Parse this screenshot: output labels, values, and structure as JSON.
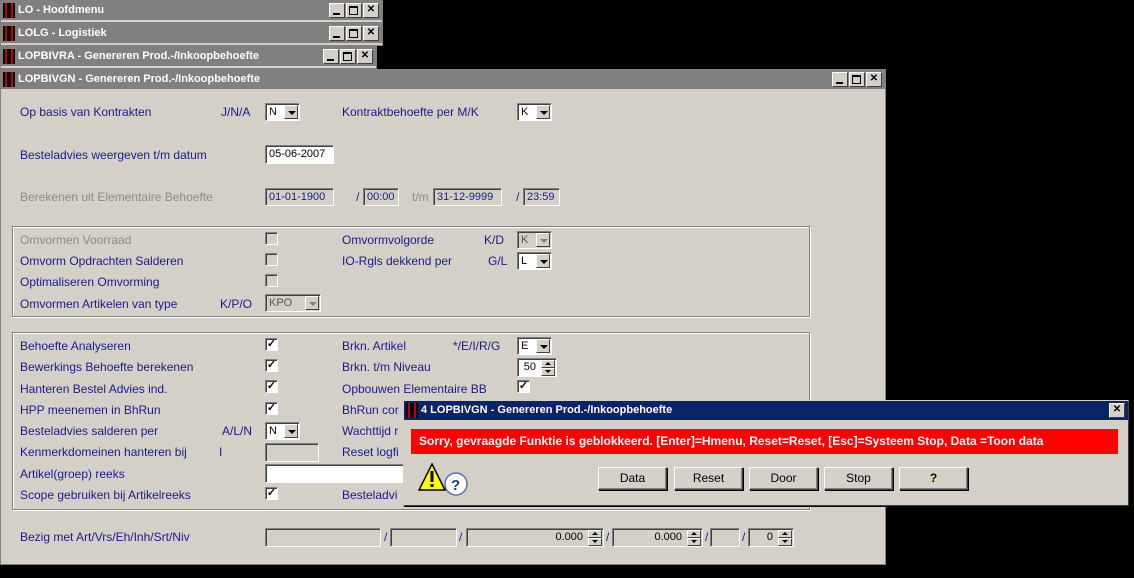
{
  "windows": {
    "w1": "LO - Hoofdmenu",
    "w2": "LOLG - Logistiek",
    "w3": "LOPBIVRA - Genereren Prod.-/Inkoopbehoefte",
    "main": "LOPBIVGN - Genereren Prod.-/Inkoopbehoefte"
  },
  "form": {
    "kontrakten_label": "Op basis van Kontrakten",
    "kontrakten_hint": "J/N/A",
    "kontrakten_value": "N",
    "kontraktbehoefte_label": "Kontraktbehoefte per M/K",
    "kontraktbehoefte_value": "K",
    "besteladvies_label": "Besteladvies weergeven t/m datum",
    "besteladvies_date": "05-06-2007",
    "berekenen_label": "Berekenen uit Elementaire Behoefte",
    "from_date": "01-01-1900",
    "from_time": "00:00",
    "tm_label": "t/m",
    "to_date": "31-12-9999",
    "to_time": "23:59",
    "slash": "/",
    "omvormen_voorraad": "Omvormen Voorraad",
    "omvorm_opdrachten": "Omvorm Opdrachten Salderen",
    "optimaliseren": "Optimaliseren Omvorming",
    "omvormen_artikelen": "Omvormen Artikelen van type",
    "omvormen_artikelen_hint": "K/P/O",
    "omvormen_artikelen_value": "KPO",
    "omvormvolgorde_label": "Omvormvolgorde",
    "omvormvolgorde_hint": "K/D",
    "omvormvolgorde_value": "K",
    "iorgls_label": "IO-Rgls dekkend per",
    "iorgls_hint": "G/L",
    "iorgls_value": "L",
    "behoefte_analyseren": "Behoefte Analyseren",
    "bewerkings": "Bewerkings Behoefte berekenen",
    "hanteren_bestel": "Hanteren Bestel Advies ind.",
    "hpp": "HPP meenemen in BhRun",
    "besteladvies_salderen": "Besteladvies salderen per",
    "besteladvies_salderen_hint": "A/L/N",
    "besteladvies_salderen_value": "N",
    "kenmerk": "Kenmerkdomeinen hanteren bij",
    "kenmerk_hint": "I",
    "artikelgroep": "Artikel(groep) reeks",
    "scope": "Scope gebruiken bij Artikelreeks",
    "brkn_artikel_label": "Brkn. Artikel",
    "brkn_artikel_hint": "*/E/I/R/G",
    "brkn_artikel_value": "E",
    "brkn_niveau_label": "Brkn. t/m Niveau",
    "brkn_niveau_value": "50",
    "opbouwen_label": "Opbouwen Elementaire BB",
    "bhrun_label": "BhRun cor",
    "wachttijd_label": "Wachttijd r",
    "reset_logfile_label": "Reset logfi",
    "besteladvi_label": "Besteladvi",
    "bezig_label": "Bezig met Art/Vrs/Eh/Inh/Srt/Niv",
    "bezig_v3": "0.000",
    "bezig_v4": "0.000",
    "bezig_v6": "0",
    "check_mark": "✓"
  },
  "dialog": {
    "title": "4 LOPBIVGN - Genereren Prod.-/Inkoopbehoefte",
    "message": "Sorry, gevraagde Funktie is geblokkeerd.  [Enter]=Hmenu, Reset=Reset, [Esc]=Systeem Stop, Data =Toon data",
    "buttons": {
      "data": "Data",
      "reset": "Reset",
      "door": "Door",
      "stop": "Stop",
      "help": "?"
    },
    "accent": "#ff0000"
  }
}
